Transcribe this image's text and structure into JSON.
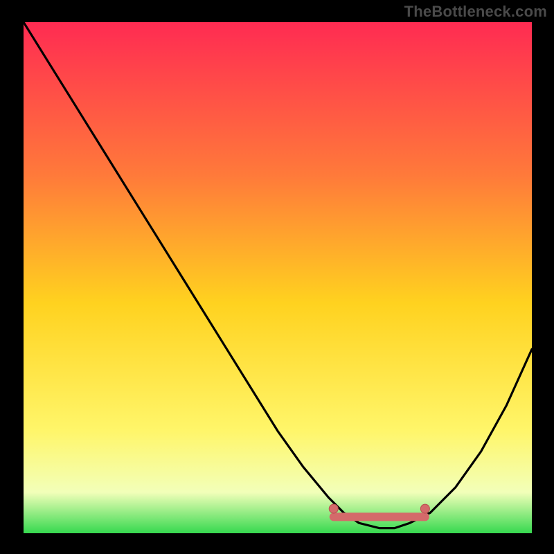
{
  "watermark": "TheBottleneck.com",
  "colors": {
    "gradient_top": "#ff2b52",
    "gradient_mid_upper": "#ff7a3a",
    "gradient_mid": "#ffd21f",
    "gradient_mid_lower": "#fff66a",
    "gradient_lower": "#f2ffb9",
    "gradient_bottom": "#36d94f",
    "curve": "#000000",
    "marker_fill": "#d46a6a",
    "marker_stroke": "#b84f4f"
  },
  "chart_data": {
    "type": "line",
    "title": "",
    "xlabel": "",
    "ylabel": "",
    "xlim": [
      0,
      100
    ],
    "ylim": [
      0,
      100
    ],
    "series": [
      {
        "name": "bottleneck-curve",
        "x": [
          0,
          5,
          10,
          15,
          20,
          25,
          30,
          35,
          40,
          45,
          50,
          55,
          60,
          63,
          66,
          70,
          73,
          76,
          80,
          85,
          90,
          95,
          100
        ],
        "y": [
          100,
          92,
          84,
          76,
          68,
          60,
          52,
          44,
          36,
          28,
          20,
          13,
          7,
          4,
          2,
          1,
          1,
          2,
          4,
          9,
          16,
          25,
          36
        ]
      }
    ],
    "flat_band": {
      "x_start": 61,
      "x_end": 79,
      "y": 3.2
    },
    "markers": [
      {
        "x": 61,
        "y": 4.8
      },
      {
        "x": 79,
        "y": 4.8
      }
    ],
    "gradient_stops": [
      {
        "offset": 0.0,
        "color_key": "gradient_top"
      },
      {
        "offset": 0.3,
        "color_key": "gradient_mid_upper"
      },
      {
        "offset": 0.55,
        "color_key": "gradient_mid"
      },
      {
        "offset": 0.8,
        "color_key": "gradient_mid_lower"
      },
      {
        "offset": 0.92,
        "color_key": "gradient_lower"
      },
      {
        "offset": 1.0,
        "color_key": "gradient_bottom"
      }
    ]
  }
}
